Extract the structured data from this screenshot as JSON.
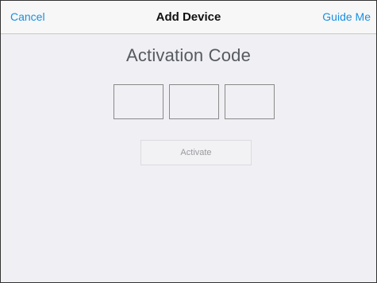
{
  "navbar": {
    "cancel_label": "Cancel",
    "title": "Add Device",
    "guide_label": "Guide Me"
  },
  "main": {
    "heading": "Activation Code",
    "code_fields": [
      "",
      "",
      ""
    ],
    "activate_label": "Activate",
    "activate_enabled": false
  },
  "colors": {
    "accent": "#1a8fe0",
    "background": "#efeff4",
    "navbar_background": "#f7f7f7",
    "heading_text": "#555a60",
    "disabled_text": "#9a9a9e"
  }
}
